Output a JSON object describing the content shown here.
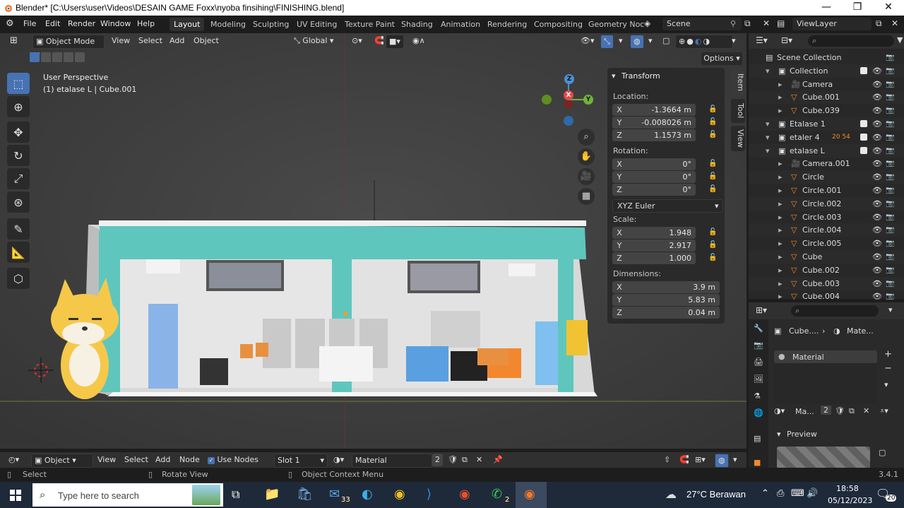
{
  "window": {
    "title": "Blender* [C:\\Users\\user\\Videos\\DESAIN GAME Foxx\\nyoba finsihing\\FINISHING.blend]",
    "minimize": "—",
    "maximize": "❐",
    "close": "✕"
  },
  "menu": {
    "items": [
      "File",
      "Edit",
      "Render",
      "Window",
      "Help"
    ],
    "workspaces": [
      "Layout",
      "Modeling",
      "Sculpting",
      "UV Editing",
      "Texture Paint",
      "Shading",
      "Animation",
      "Rendering",
      "Compositing",
      "Geometry Noc"
    ],
    "scene": "Scene",
    "view_layer": "ViewLayer"
  },
  "viewport_header": {
    "mode": "Object Mode",
    "view": "View",
    "select": "Select",
    "add": "Add",
    "object": "Object",
    "orientation": "Global",
    "options": "Options"
  },
  "viewport": {
    "perspective": "User Perspective",
    "active": "(1) etalase L | Cube.001",
    "nav_axes": [
      "X",
      "Y",
      "Z"
    ]
  },
  "side_tabs": [
    "Item",
    "Tool",
    "View"
  ],
  "transform": {
    "title": "Transform",
    "location_label": "Location:",
    "location": [
      [
        "X",
        "-1.3664 m"
      ],
      [
        "Y",
        "-0.008026 m"
      ],
      [
        "Z",
        "1.1573 m"
      ]
    ],
    "rotation_label": "Rotation:",
    "rotation": [
      [
        "X",
        "0°"
      ],
      [
        "Y",
        "0°"
      ],
      [
        "Z",
        "0°"
      ]
    ],
    "rotation_mode": "XYZ Euler",
    "scale_label": "Scale:",
    "scale": [
      [
        "X",
        "1.948"
      ],
      [
        "Y",
        "2.917"
      ],
      [
        "Z",
        "1.000"
      ]
    ],
    "dimensions_label": "Dimensions:",
    "dimensions": [
      [
        "X",
        "3.9 m"
      ],
      [
        "Y",
        "5.83 m"
      ],
      [
        "Z",
        "0.04 m"
      ]
    ]
  },
  "outliner": {
    "rows": [
      {
        "name": "Scene Collection",
        "indent": 0,
        "type": "scene"
      },
      {
        "name": "Collection",
        "indent": 1,
        "type": "collection",
        "check": true
      },
      {
        "name": "Camera",
        "indent": 2,
        "type": "camera"
      },
      {
        "name": "Cube.001",
        "indent": 2,
        "type": "mesh"
      },
      {
        "name": "Cube.039",
        "indent": 2,
        "type": "mesh"
      },
      {
        "name": "Etalase 1",
        "indent": 1,
        "type": "collection",
        "check": true
      },
      {
        "name": "etaler 4",
        "indent": 1,
        "type": "collection",
        "check": true,
        "extra": "20  54"
      },
      {
        "name": "etalase L",
        "indent": 1,
        "type": "collection",
        "check": true
      },
      {
        "name": "Camera.001",
        "indent": 2,
        "type": "camera"
      },
      {
        "name": "Circle",
        "indent": 2,
        "type": "mesh"
      },
      {
        "name": "Circle.001",
        "indent": 2,
        "type": "mesh"
      },
      {
        "name": "Circle.002",
        "indent": 2,
        "type": "mesh"
      },
      {
        "name": "Circle.003",
        "indent": 2,
        "type": "mesh"
      },
      {
        "name": "Circle.004",
        "indent": 2,
        "type": "mesh"
      },
      {
        "name": "Circle.005",
        "indent": 2,
        "type": "mesh"
      },
      {
        "name": "Cube",
        "indent": 2,
        "type": "mesh"
      },
      {
        "name": "Cube.002",
        "indent": 2,
        "type": "mesh"
      },
      {
        "name": "Cube.003",
        "indent": 2,
        "type": "mesh"
      },
      {
        "name": "Cube.004",
        "indent": 2,
        "type": "mesh"
      }
    ]
  },
  "properties": {
    "breadcrumb_obj": "Cube....",
    "breadcrumb_mat": "Mate...",
    "material_slot": "Material",
    "material_short": "Ma...",
    "users": "2",
    "preview": "Preview"
  },
  "node_header": {
    "type": "Object",
    "view": "View",
    "select": "Select",
    "add": "Add",
    "node": "Node",
    "use_nodes": "Use Nodes",
    "slot": "Slot 1",
    "material": "Material",
    "users": "2"
  },
  "statusbar": {
    "select": "Select",
    "rotate": "Rotate View",
    "context": "Object Context Menu",
    "version": "3.4.1"
  },
  "taskbar": {
    "search": "Type here to search",
    "weather": "27°C  Berawan",
    "time": "18:58",
    "date": "05/12/2023",
    "mail_badge": "33",
    "whatsapp_badge": "2",
    "notif_badge": "20"
  },
  "colors": {
    "accent": "#4772b3",
    "teal": "#5fc6bd",
    "panel": "#2a2a2a",
    "header": "#303030"
  }
}
